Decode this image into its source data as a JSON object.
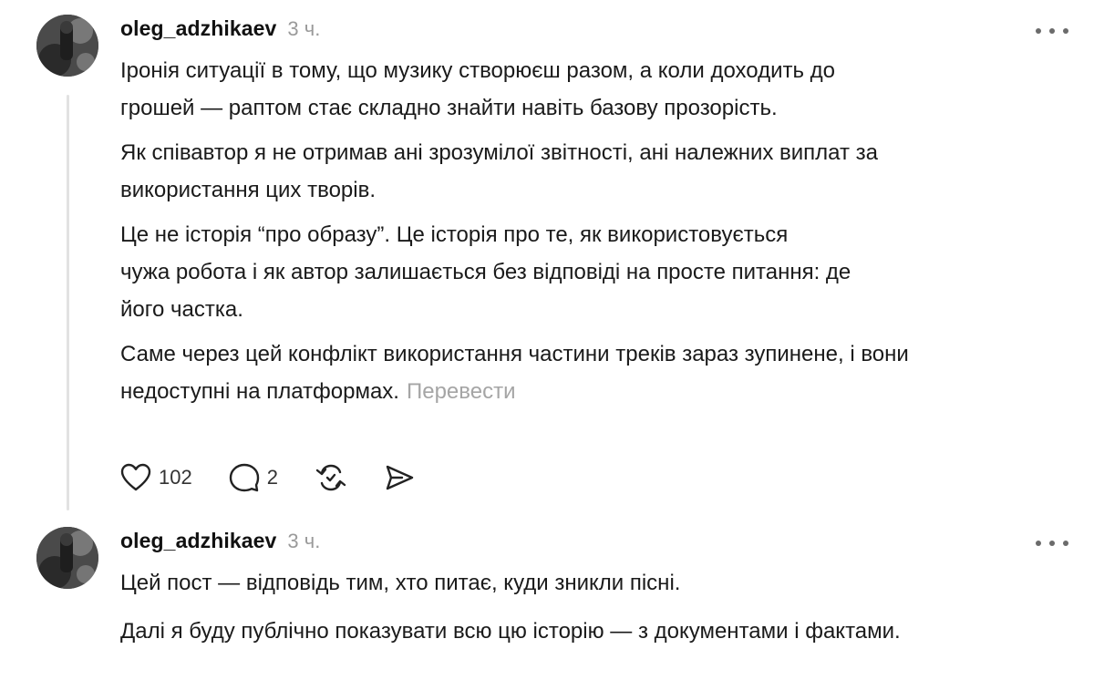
{
  "posts": [
    {
      "username": "oleg_adzhikaev",
      "time": "3 ч.",
      "paragraphs": [
        [
          "Іронія ситуації в тому, що музику створюєш разом, а коли доходить до",
          "грошей — раптом стає складно знайти навіть базову прозорість."
        ],
        [
          "Як співавтор я не отримав ані зрозумілої звітності, ані належних виплат за",
          "використання цих творів."
        ],
        [
          "Це не історія “про образу”. Це історія про те, як використовується",
          "чужа робота і як автор залишається без відповіді на просте питання: де",
          "його частка."
        ],
        [
          "Саме через цей конфлікт використання частини треків зараз зупинене, і вони",
          "недоступні на платформах."
        ]
      ],
      "translate_label": "Перевести",
      "likes": "102",
      "replies": "2"
    },
    {
      "username": "oleg_adzhikaev",
      "time": "3 ч.",
      "paragraphs": [
        [
          "Цей пост — відповідь тим, хто питає, куди зникли пісні."
        ],
        [
          "Далі я буду публічно показувати всю цю історію — з документами і фактами."
        ]
      ]
    }
  ],
  "icons": {
    "like": "heart-icon",
    "reply": "comment-icon",
    "repost": "repost-icon",
    "share": "send-icon",
    "more": "more-horizontal-icon"
  }
}
